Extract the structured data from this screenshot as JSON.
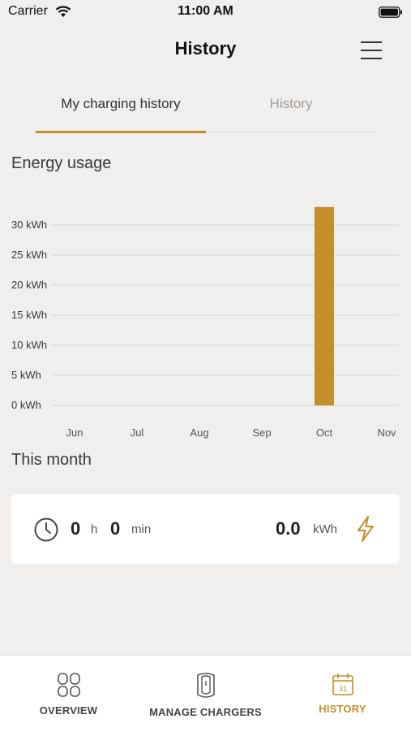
{
  "status_bar": {
    "carrier": "Carrier",
    "time": "11:00 AM"
  },
  "header": {
    "title": "History"
  },
  "tabs": [
    {
      "label": "My charging history",
      "active": true
    },
    {
      "label": "History",
      "active": false
    }
  ],
  "energy_section": {
    "title": "Energy usage"
  },
  "chart_data": {
    "type": "bar",
    "categories": [
      "Jun",
      "Jul",
      "Aug",
      "Sep",
      "Oct",
      "Nov"
    ],
    "values": [
      0,
      0,
      0,
      0,
      33,
      0
    ],
    "y_ticks": [
      "0 kWh",
      "5 kWh",
      "10 kWh",
      "15 kWh",
      "20 kWh",
      "25 kWh",
      "30 kWh"
    ],
    "y_tick_values": [
      0,
      5,
      10,
      15,
      20,
      25,
      30
    ],
    "ylim": [
      0,
      30
    ],
    "grid": true,
    "bar_color": "#c48e2a"
  },
  "this_month": {
    "title": "This month",
    "hours": "0",
    "hours_unit": "h",
    "minutes": "0",
    "minutes_unit": "min",
    "energy": "0.0",
    "energy_unit": "kWh"
  },
  "bottom_nav": [
    {
      "label": "OVERVIEW",
      "icon": "overview-icon",
      "active": false
    },
    {
      "label": "MANAGE CHARGERS",
      "icon": "charger-icon",
      "active": false
    },
    {
      "label": "HISTORY",
      "icon": "calendar-icon",
      "active": true,
      "calendar_day": "31"
    }
  ],
  "colors": {
    "accent": "#c48e2a",
    "background": "#f1efed",
    "card": "#ffffff"
  }
}
